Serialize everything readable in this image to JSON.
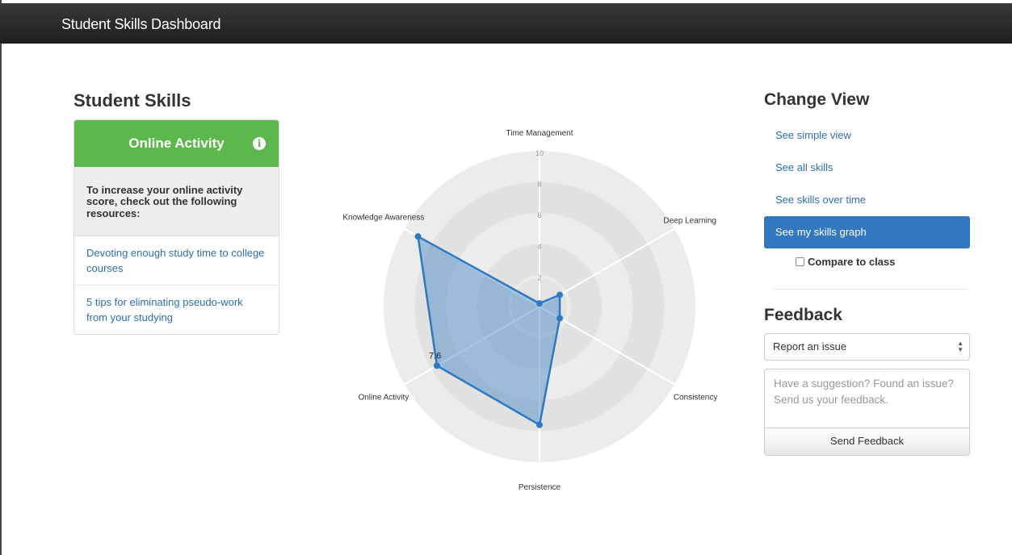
{
  "navbar": {
    "brand": "Student Skills Dashboard"
  },
  "left": {
    "title": "Student Skills",
    "panel": {
      "heading": "Online Activity",
      "tip": "To increase your online activity score, check out the following resources:",
      "links": [
        "Devoting enough study time to college courses",
        "5 tips for eliminating pseudo-work from your studying"
      ]
    }
  },
  "chart_data": {
    "type": "radar",
    "axes": [
      "Time Management",
      "Deep Learning",
      "Consistency",
      "Persistence",
      "Online Activity",
      "Knowledge Awareness"
    ],
    "values": [
      0.2,
      1.5,
      1.5,
      7.6,
      7.6,
      9.0
    ],
    "rlim": [
      0,
      10
    ],
    "ticks": [
      "2",
      "4",
      "6",
      "8",
      "10"
    ],
    "data_label": "7.6",
    "colors": {
      "fill": "#3d82c4",
      "stroke": "#2f78c2",
      "ring_dark": "#e2e2e2",
      "ring_light": "#ececec"
    }
  },
  "right": {
    "change_view_title": "Change View",
    "nav": [
      "See simple view",
      "See all skills",
      "See skills over time",
      "See my skills graph"
    ],
    "compare_label": "Compare to class",
    "feedback_title": "Feedback",
    "select_value": "Report an issue",
    "textarea_placeholder": "Have a suggestion? Found an issue? Send us your feedback.",
    "send_label": "Send Feedback"
  }
}
